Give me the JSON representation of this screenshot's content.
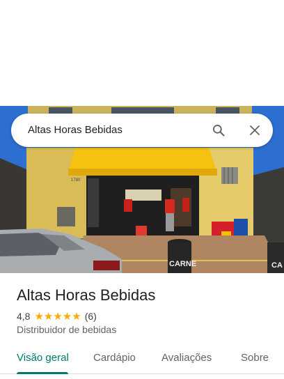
{
  "search": {
    "query": "Altas Horas Bebidas"
  },
  "place": {
    "name": "Altas Horas Bebidas",
    "rating": "4,8",
    "stars": "★★★★★",
    "reviews": "(6)",
    "category": "Distribuidor de bebidas"
  },
  "photo": {
    "storefront_number": "1780",
    "bin_label": "CARNE"
  },
  "tabs": [
    {
      "label": "Visão geral",
      "active": true
    },
    {
      "label": "Cardápio"
    },
    {
      "label": "Avaliações"
    },
    {
      "label": "Sobre"
    }
  ],
  "colors": {
    "accent": "#00796b",
    "star": "#f9ab00",
    "awning": "#f5c211"
  }
}
